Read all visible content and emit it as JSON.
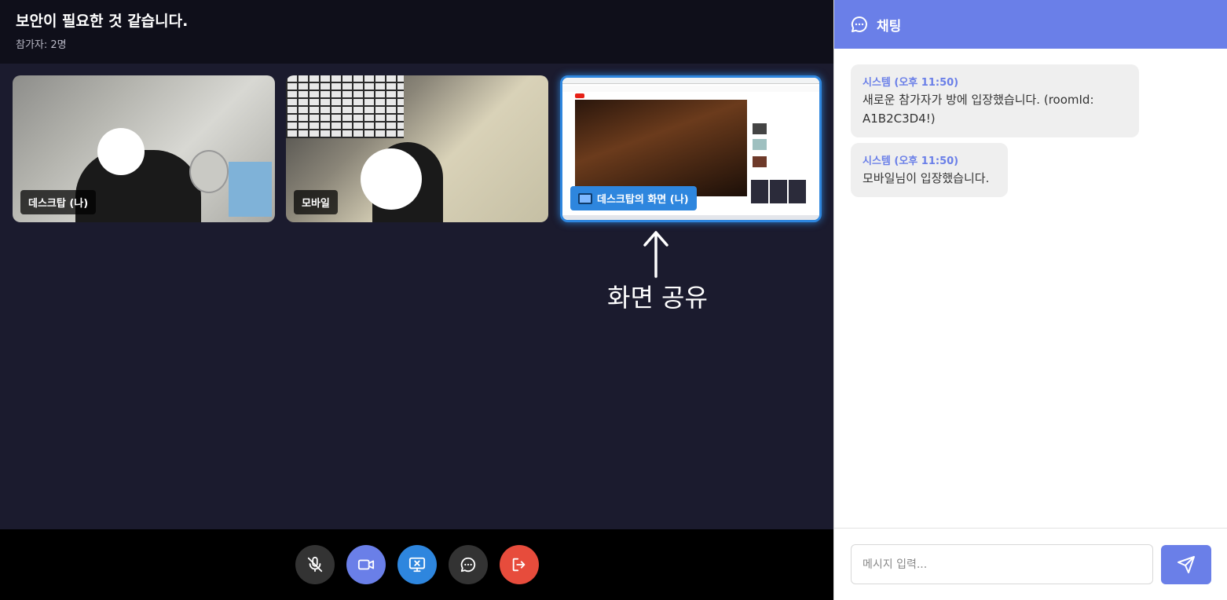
{
  "header": {
    "title": "보안이 필요한 것 같습니다.",
    "participants": "참가자: 2명"
  },
  "tiles": [
    {
      "label": "데스크탑 (나)"
    },
    {
      "label": "모바일"
    },
    {
      "label": "데스크탑의 화면 (나)",
      "icon": "monitor-icon"
    }
  ],
  "annotation": {
    "text": "화면 공유"
  },
  "controls": {
    "mic": {
      "icon": "mic-off-icon",
      "color": "#333333"
    },
    "camera": {
      "icon": "video-icon",
      "color": "#6a7fe8"
    },
    "screen": {
      "icon": "screen-share-icon",
      "color": "#2e86de"
    },
    "chat": {
      "icon": "chat-bubble-icon",
      "color": "#333333"
    },
    "leave": {
      "icon": "exit-icon",
      "color": "#e74c3c"
    }
  },
  "chat": {
    "title": "채팅",
    "messages": [
      {
        "sender": "시스템 (오후 11:50)",
        "text": "새로운 참가자가 방에 입장했습니다. (roomId: A1B2C3D4!)"
      },
      {
        "sender": "시스템 (오후 11:50)",
        "text": "모바일님이 입장했습니다."
      }
    ],
    "input_placeholder": "메시지 입력..."
  }
}
